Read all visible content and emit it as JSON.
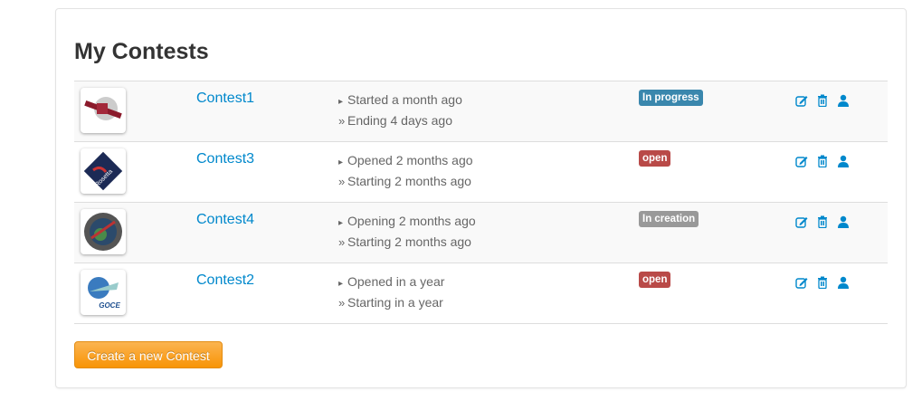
{
  "title": "My Contests",
  "colors": {
    "link": "#0088cc",
    "in_progress": "#3a87ad",
    "open": "#b94a48",
    "in_creation": "#999999",
    "button": "#f89406"
  },
  "contests": [
    {
      "name": "Contest1",
      "line1": "Started a month ago",
      "line2": "Ending 4 days ago",
      "status": "In progress",
      "status_color": "#3a87ad",
      "logo": "satellite"
    },
    {
      "name": "Contest3",
      "line1": "Opened 2 months ago",
      "line2": "Starting 2 months ago",
      "status": "open",
      "status_color": "#b94a48",
      "logo": "rosetta"
    },
    {
      "name": "Contest4",
      "line1": "Opening 2 months ago",
      "line2": "Starting 2 months ago",
      "status": "In creation",
      "status_color": "#999999",
      "logo": "mission-patch"
    },
    {
      "name": "Contest2",
      "line1": "Opened in a year",
      "line2": "Starting in a year",
      "status": "open",
      "status_color": "#b94a48",
      "logo": "goce"
    }
  ],
  "logo_text": {
    "rosetta": "Rosetta",
    "goce": "GOCE"
  },
  "create_button": "Create a new Contest"
}
